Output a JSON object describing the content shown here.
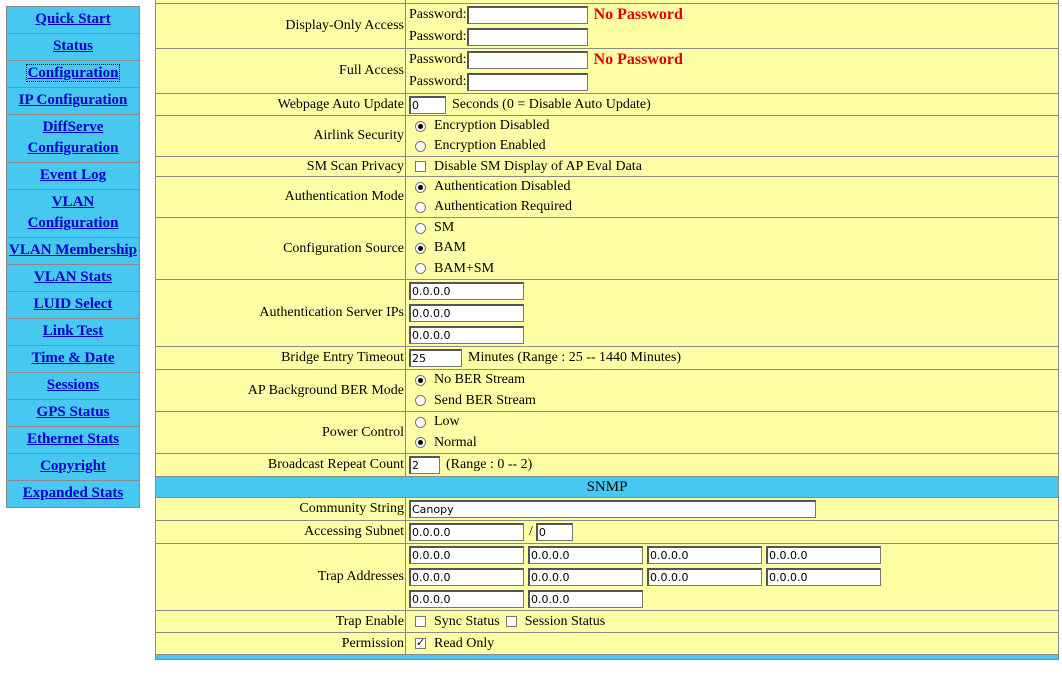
{
  "nav": {
    "items": [
      {
        "label": "Quick Start"
      },
      {
        "label": "Status"
      },
      {
        "label": "Configuration"
      },
      {
        "label": "IP Configuration"
      },
      {
        "label": "DiffServe Configuration"
      },
      {
        "label": "Event Log"
      },
      {
        "label": "VLAN Configuration"
      },
      {
        "label": "VLAN Membership"
      },
      {
        "label": "VLAN Stats"
      },
      {
        "label": "LUID Select"
      },
      {
        "label": "Link Test"
      },
      {
        "label": "Time & Date"
      },
      {
        "label": "Sessions"
      },
      {
        "label": "GPS Status"
      },
      {
        "label": "Ethernet Stats"
      },
      {
        "label": "Copyright"
      },
      {
        "label": "Expanded Stats"
      }
    ],
    "active": "Configuration"
  },
  "colors": {
    "nav_bg": "#46c8f0",
    "form_bg": "#ffffa6",
    "link": "#0000cc",
    "warning": "#e00000"
  },
  "form": {
    "display_only_access": {
      "label": "Display-Only Access",
      "pw_label": "Password:",
      "status": "No Password"
    },
    "full_access": {
      "label": "Full Access",
      "pw_label": "Password:",
      "status": "No Password"
    },
    "webpage_auto_update": {
      "label": "Webpage Auto Update",
      "value": "0",
      "hint": "Seconds (0 = Disable Auto Update)"
    },
    "airlink_security": {
      "label": "Airlink Security",
      "options": [
        "Encryption Disabled",
        "Encryption Enabled"
      ],
      "selected": 0
    },
    "sm_scan_privacy": {
      "label": "SM Scan Privacy",
      "option": "Disable SM Display of AP Eval Data",
      "checked": false
    },
    "authentication_mode": {
      "label": "Authentication Mode",
      "options": [
        "Authentication Disabled",
        "Authentication Required"
      ],
      "selected": 0
    },
    "configuration_source": {
      "label": "Configuration Source",
      "options": [
        "SM",
        "BAM",
        "BAM+SM"
      ],
      "selected": 1
    },
    "auth_server_ips": {
      "label": "Authentication Server IPs",
      "values": [
        "0.0.0.0",
        "0.0.0.0",
        "0.0.0.0"
      ]
    },
    "bridge_entry_timeout": {
      "label": "Bridge Entry Timeout",
      "value": "25",
      "hint": "Minutes (Range : 25 -- 1440 Minutes)"
    },
    "ap_background_ber_mode": {
      "label": "AP Background BER Mode",
      "options": [
        "No BER Stream",
        "Send BER Stream"
      ],
      "selected": 0
    },
    "power_control": {
      "label": "Power Control",
      "options": [
        "Low",
        "Normal"
      ],
      "selected": 1
    },
    "broadcast_repeat_count": {
      "label": "Broadcast Repeat Count",
      "value": "2",
      "hint": "(Range : 0 -- 2)"
    }
  },
  "snmp": {
    "title": "SNMP",
    "community_string": {
      "label": "Community String",
      "value": "Canopy"
    },
    "accessing_subnet": {
      "label": "Accessing Subnet",
      "value": "0.0.0.0",
      "sep": "/",
      "mask": "0"
    },
    "trap_addresses": {
      "label": "Trap Addresses",
      "values": [
        "0.0.0.0",
        "0.0.0.0",
        "0.0.0.0",
        "0.0.0.0",
        "0.0.0.0",
        "0.0.0.0",
        "0.0.0.0",
        "0.0.0.0",
        "0.0.0.0",
        "0.0.0.0"
      ]
    },
    "trap_enable": {
      "label": "Trap Enable",
      "options": [
        "Sync Status",
        "Session Status"
      ],
      "checked": [
        false,
        false
      ]
    },
    "permission": {
      "label": "Permission",
      "option": "Read Only",
      "checked": true
    }
  }
}
